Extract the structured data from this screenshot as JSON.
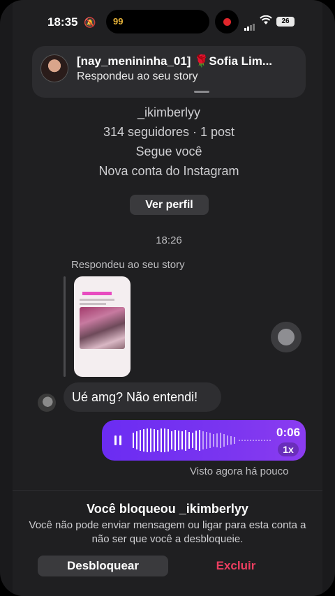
{
  "status_bar": {
    "time": "18:35",
    "island_badge": "99",
    "battery": "26"
  },
  "notification": {
    "title": "[nay_menininha_01] 🌹Sofia Lim...",
    "subtitle": "Respondeu ao seu story"
  },
  "profile": {
    "username": "_ikimberlyy",
    "stats": "314 seguidores · 1 post",
    "follows_you": "Segue você",
    "new_account": "Nova conta do Instagram",
    "view_profile": "Ver perfil"
  },
  "chat": {
    "timestamp": "18:26",
    "reply_label": "Respondeu ao seu story",
    "incoming_message": "Ué amg? Não entendi!",
    "audio_duration": "0:06",
    "audio_speed": "1x",
    "seen_label": "Visto agora há pouco"
  },
  "blocked_panel": {
    "title": "Você bloqueou _ikimberlyy",
    "description": "Você não pode enviar mensagem ou ligar para esta conta a não ser que você a desbloqueie.",
    "unblock_label": "Desbloquear",
    "delete_label": "Excluir"
  },
  "icons": [
    "bell-slash-icon",
    "signal-icon",
    "wifi-icon",
    "battery-icon",
    "pause-icon",
    "waveform-icon"
  ],
  "colors": {
    "accent": "#7a35f0",
    "danger": "#ec3e60",
    "record": "#e0262b"
  }
}
